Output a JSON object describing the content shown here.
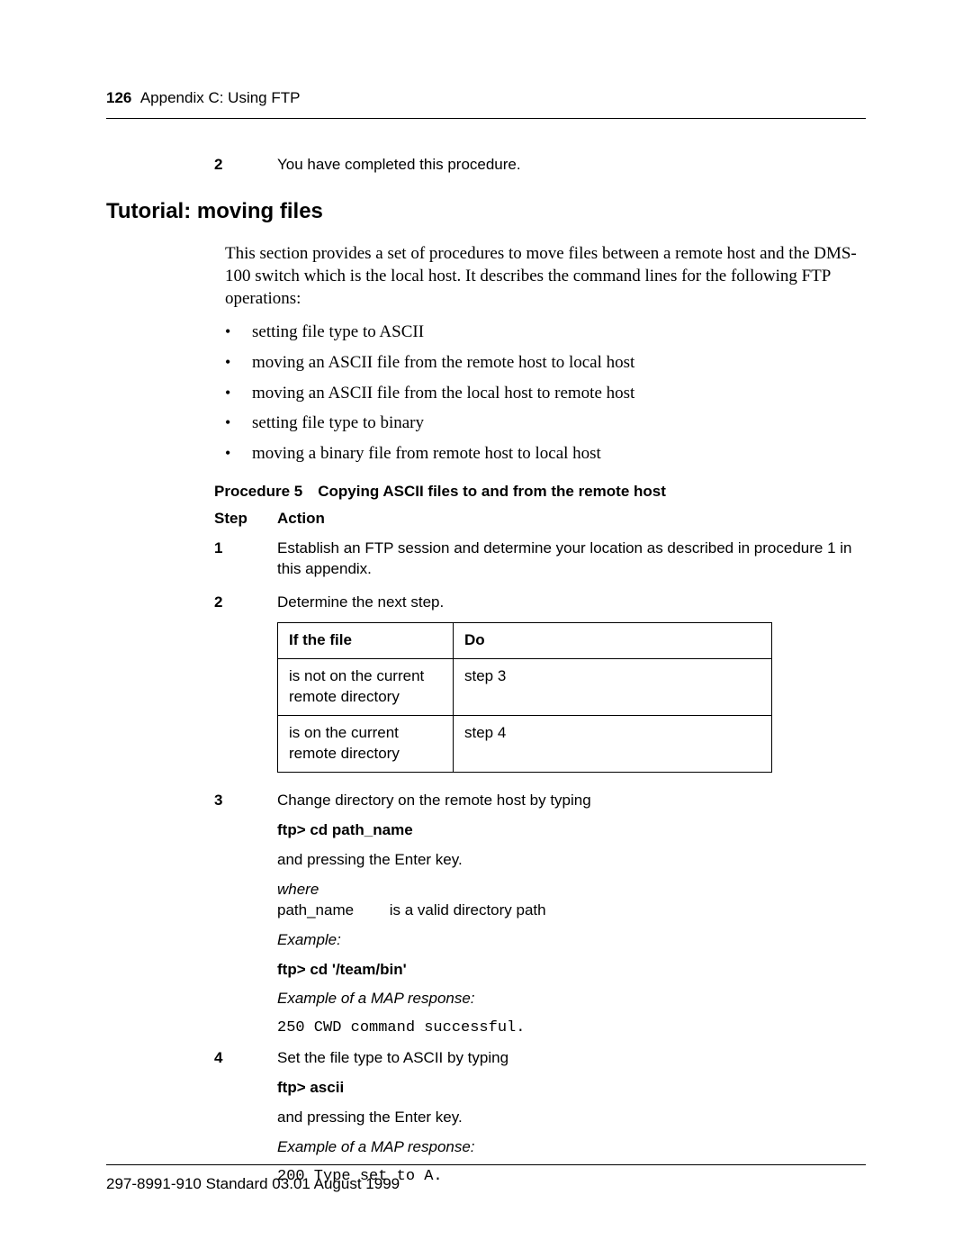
{
  "header": {
    "page_number": "126",
    "section": "Appendix C: Using FTP"
  },
  "prev_step": {
    "num": "2",
    "text": "You have completed this procedure."
  },
  "heading": "Tutorial: moving files",
  "intro": "This section provides a set of procedures to move files between a remote host and the DMS-100 switch which is the local host. It describes the command lines for the following FTP operations:",
  "bullets": [
    "setting file type to ASCII",
    "moving an ASCII file from the remote host to local host",
    "moving an ASCII file from the local host to remote host",
    "setting file type to binary",
    "moving a binary file from remote host to local host"
  ],
  "procedure_title": "Procedure 5 Copying ASCII files to and from the remote host",
  "table_header": {
    "step": "Step",
    "action": "Action"
  },
  "steps": {
    "s1": {
      "num": "1",
      "text": "Establish an FTP session and determine your location as described in procedure 1 in this appendix."
    },
    "s2": {
      "num": "2",
      "text": "Determine the next step."
    },
    "s3": {
      "num": "3",
      "text": "Change directory on the remote host by typing",
      "cmd": "ftp> cd path_name",
      "after": "and pressing the Enter key.",
      "where_label": "where",
      "where_term": "path_name",
      "where_def": "is a valid directory path",
      "example_label": "Example:",
      "example_cmd": "ftp> cd  '/team/bin'",
      "map_label": "Example of a MAP response:",
      "map_response": "250 CWD command successful."
    },
    "s4": {
      "num": "4",
      "text": "Set the file type to ASCII by typing",
      "cmd": "ftp> ascii",
      "after": "and pressing the Enter key.",
      "map_label": "Example of a MAP response:",
      "map_response": "200 Type set to A."
    }
  },
  "decision_table": {
    "h1": "If the file",
    "h2": "Do",
    "rows": [
      {
        "c1": "is not on the current remote directory",
        "c2": "step 3"
      },
      {
        "c1": "is on the current remote directory",
        "c2": "step 4"
      }
    ]
  },
  "footer": "297-8991-910  Standard  03.01  August 1999"
}
